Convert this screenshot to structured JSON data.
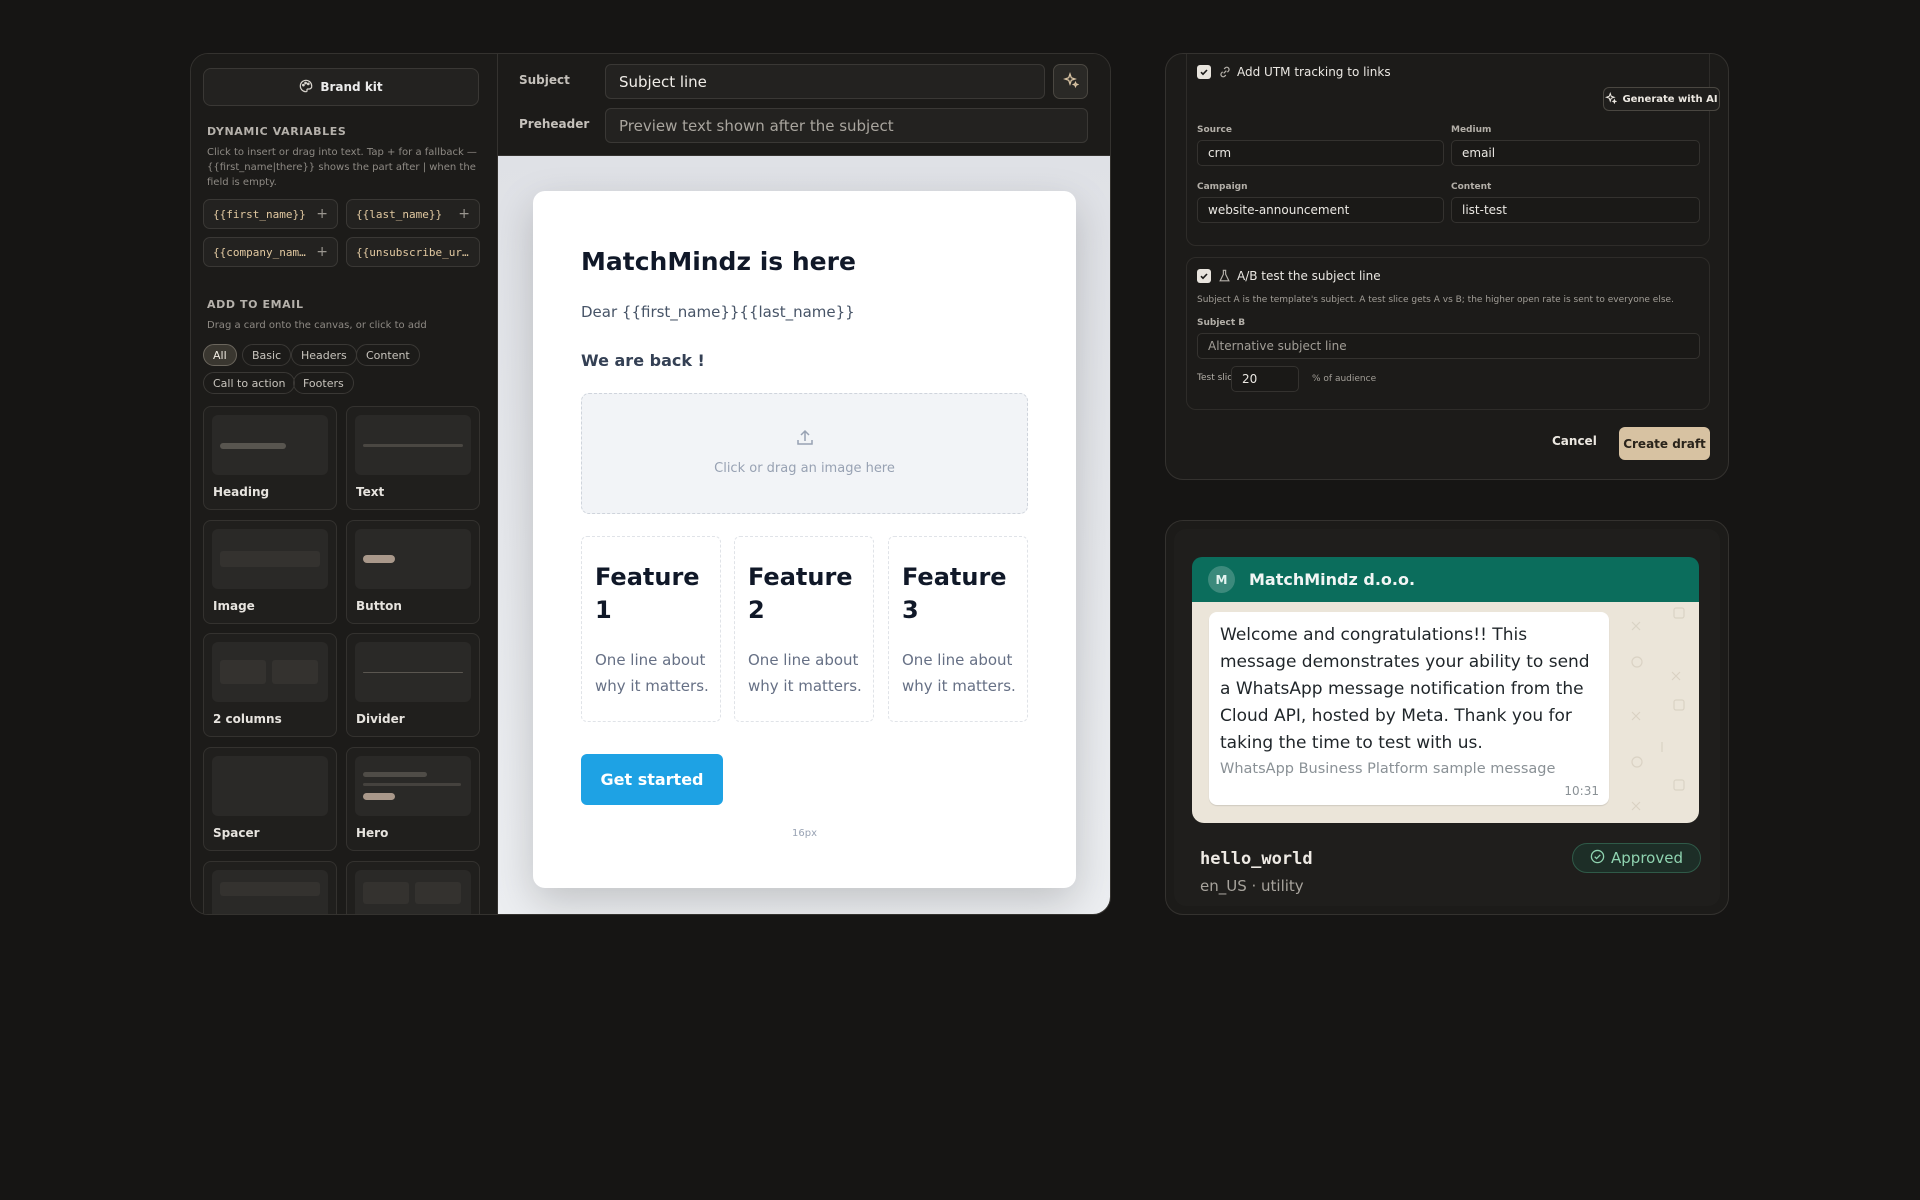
{
  "sidebar": {
    "brand_kit": "Brand kit",
    "dynamic_title": "DYNAMIC VARIABLES",
    "dynamic_desc": "Click to insert or drag into text. Tap + for a fallback — {{first_name|there}} shows the part after | when the field is empty.",
    "variables": [
      "{{first_name}}",
      "{{last_name}}",
      "{{company_name}}",
      "{{unsubscribe_url}}"
    ],
    "add_title": "ADD TO EMAIL",
    "add_desc": "Drag a card onto the canvas, or click to add",
    "filters": [
      "All",
      "Basic",
      "Headers",
      "Content",
      "Call to action",
      "Footers"
    ],
    "blocks": [
      "Heading",
      "Text",
      "Image",
      "Button",
      "2 columns",
      "Divider",
      "Spacer",
      "Hero"
    ]
  },
  "header": {
    "subject_label": "Subject",
    "subject_value": "Subject line",
    "preheader_label": "Preheader",
    "preheader_placeholder": "Preview text shown after the subject"
  },
  "email": {
    "title": "MatchMindz is here",
    "greeting": "Dear {{first_name}}{{last_name}}",
    "subheading": "We are back !",
    "image_placeholder": "Click or drag an image here",
    "features": [
      {
        "title": "Feature 1",
        "text": "One line about why it matters."
      },
      {
        "title": "Feature 2",
        "text": "One line about why it matters."
      },
      {
        "title": "Feature 3",
        "text": "One line about why it matters."
      }
    ],
    "cta": "Get started",
    "spacer_label": "16px"
  },
  "campaign": {
    "utm_label": "Add UTM tracking to links",
    "generate_ai": "Generate with AI",
    "source_label": "Source",
    "source_value": "crm",
    "medium_label": "Medium",
    "medium_value": "email",
    "campaign_label": "Campaign",
    "campaign_value": "website-announcement",
    "content_label": "Content",
    "content_value": "list-test",
    "ab_label": "A/B test the subject line",
    "ab_desc": "Subject A is the template's subject. A test slice gets A vs B; the higher open rate is sent to everyone else.",
    "subject_b_label": "Subject B",
    "subject_b_placeholder": "Alternative subject line",
    "test_slice_label": "Test slice",
    "test_slice_value": "20",
    "test_slice_unit": "% of audience",
    "cancel": "Cancel",
    "create_draft": "Create draft"
  },
  "whatsapp": {
    "avatar_letter": "M",
    "business_name": "MatchMindz d.o.o.",
    "message": "Welcome and congratulations!! This message demonstrates your ability to send a WhatsApp message notification from the Cloud API, hosted by Meta. Thank you for taking the time to test with us.",
    "footer": "WhatsApp Business Platform sample message",
    "time": "10:31",
    "template_name": "hello_world",
    "template_meta": "en_US · utility",
    "status": "Approved"
  },
  "colors": {
    "accent": "#d7c2a2",
    "cta_blue": "#1ea2e4",
    "whatsapp_green": "#0b6d5c",
    "approved_green": "#8fd3b0"
  },
  "icons": {
    "brand_kit": "palette-icon",
    "magic": "sparkle-icon",
    "link": "link-icon",
    "flask": "flask-icon",
    "upload": "upload-icon",
    "status": "check-circle-icon"
  }
}
